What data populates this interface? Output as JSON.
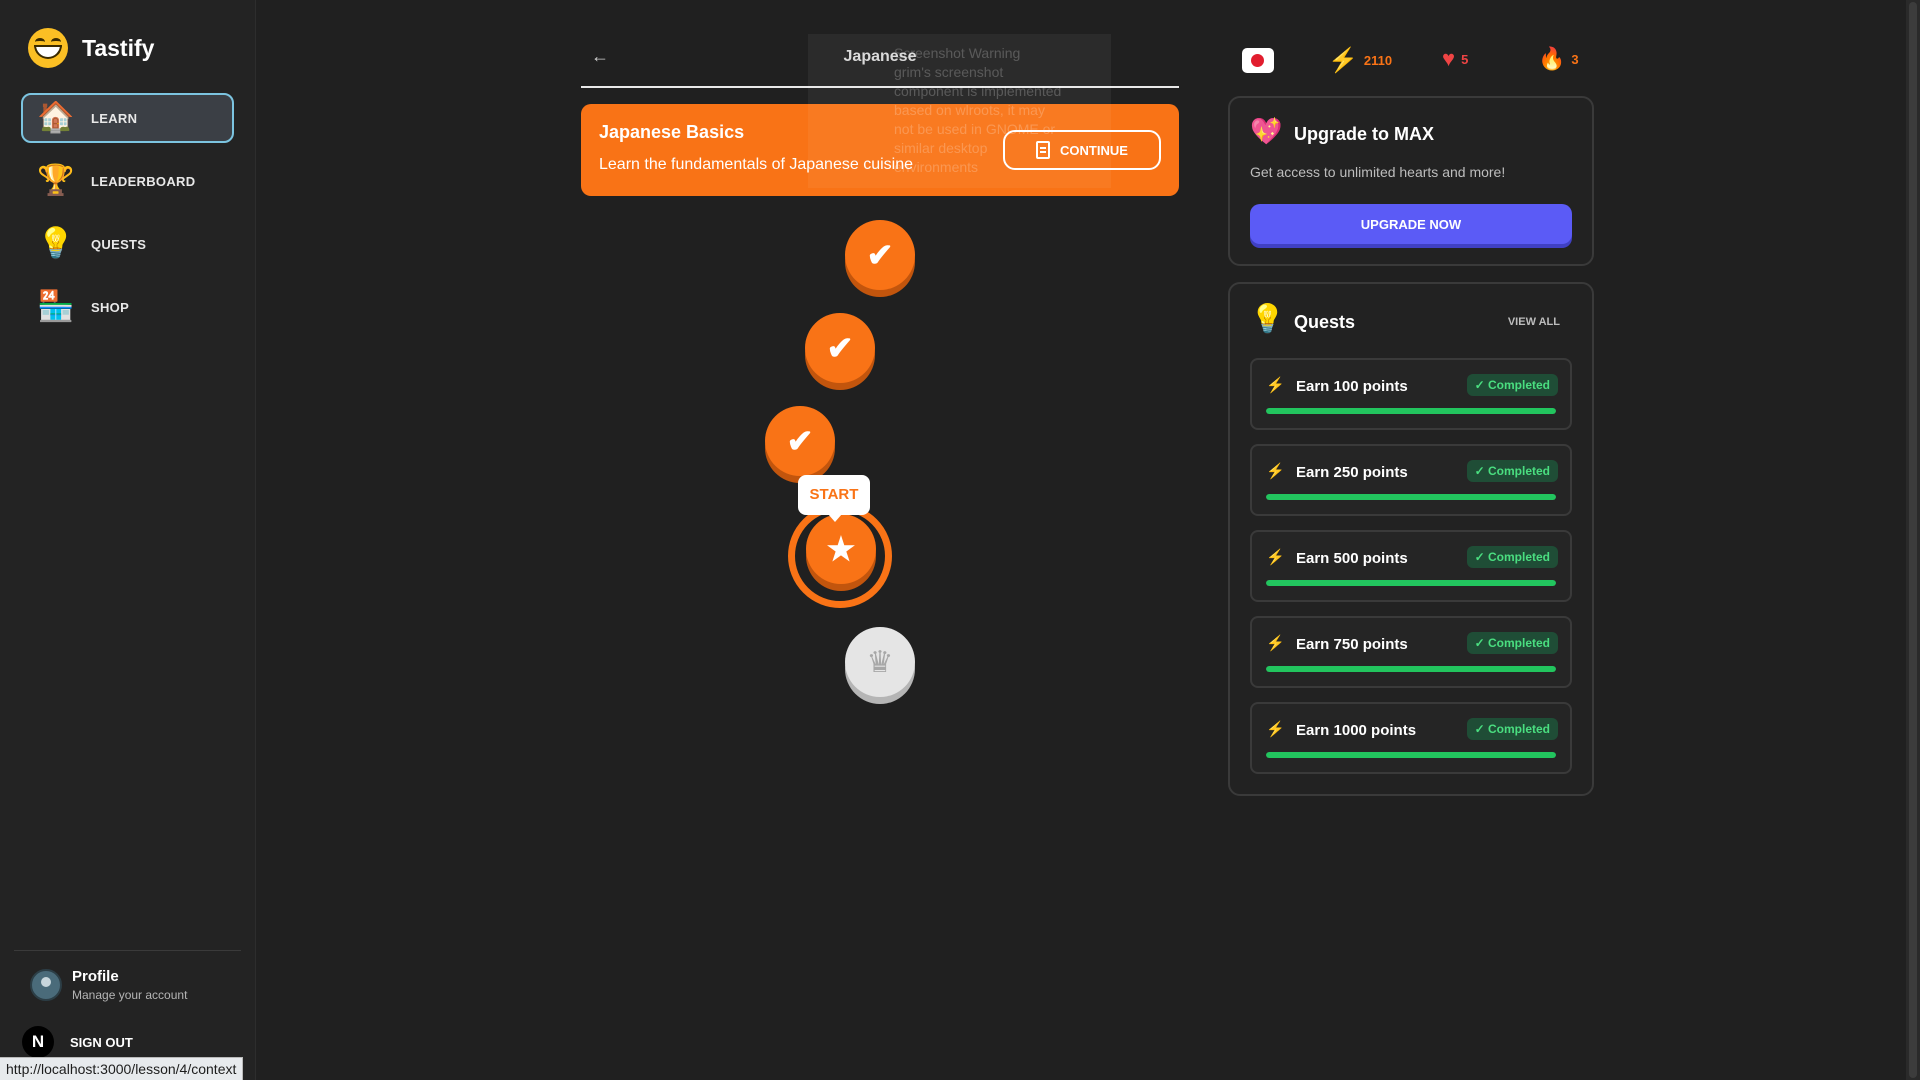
{
  "app": {
    "name": "Tastify"
  },
  "sidebar": {
    "items": [
      {
        "label": "LEARN",
        "icon": "house-icon",
        "active": true
      },
      {
        "label": "LEADERBOARD",
        "icon": "podium-icon"
      },
      {
        "label": "QUESTS",
        "icon": "lightbulb-icon"
      },
      {
        "label": "SHOP",
        "icon": "shop-icon"
      }
    ],
    "profile": {
      "title": "Profile",
      "subtitle": "Manage your account"
    },
    "signout": {
      "badge": "N",
      "label": "SIGN OUT"
    }
  },
  "status_url": "http://localhost:3000/lesson/4/context",
  "header": {
    "title": "Japanese"
  },
  "overlay_warning": "Screenshot Warning\ngrim's screenshot\ncomponent is implemented\nbased on wlroots, it may\nnot be used in GNOME or\nsimilar desktop\nenvironments",
  "unit": {
    "title": "Japanese Basics",
    "description": "Learn the fundamentals of Japanese cuisine",
    "continue_label": "CONTINUE"
  },
  "path": {
    "start_label": "START",
    "lessons": [
      {
        "state": "completed"
      },
      {
        "state": "completed"
      },
      {
        "state": "completed"
      },
      {
        "state": "current"
      },
      {
        "state": "locked"
      }
    ]
  },
  "stats": {
    "flag": "japan-flag-icon",
    "points": "2110",
    "hearts": "5",
    "streak": "3",
    "colors": {
      "points": "#f97316",
      "hearts": "#ef4444",
      "streak": "#f97316"
    }
  },
  "upgrade": {
    "title": "Upgrade to MAX",
    "description": "Get access to unlimited hearts and more!",
    "button": "UPGRADE NOW"
  },
  "quests": {
    "title": "Quests",
    "view_all": "VIEW ALL",
    "items": [
      {
        "label": "Earn 100 points",
        "status": "✓ Completed",
        "progress": 1.0
      },
      {
        "label": "Earn 250 points",
        "status": "✓ Completed",
        "progress": 1.0
      },
      {
        "label": "Earn 500 points",
        "status": "✓ Completed",
        "progress": 1.0
      },
      {
        "label": "Earn 750 points",
        "status": "✓ Completed",
        "progress": 1.0
      },
      {
        "label": "Earn 1000 points",
        "status": "✓ Completed",
        "progress": 1.0
      }
    ]
  },
  "colors": {
    "accent": "#f97316",
    "upgrade": "#5b5bf6",
    "success": "#22c55e"
  }
}
